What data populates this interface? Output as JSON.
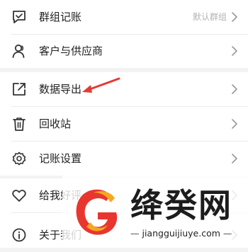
{
  "menu": {
    "group_ledger": {
      "label": "群组记账",
      "value": "默认群组"
    },
    "customers_suppliers": {
      "label": "客户与供应商"
    },
    "data_export": {
      "label": "数据导出"
    },
    "recycle_bin": {
      "label": "回收站"
    },
    "bookkeeping_settings": {
      "label": "记账设置"
    },
    "rate_us": {
      "label": "给我好评"
    },
    "about_us": {
      "label": "关于我们"
    }
  },
  "icons": {
    "group_ledger": "chat-bubble-icon",
    "customers_suppliers": "user-icon",
    "data_export": "export-icon",
    "recycle_bin": "trash-icon",
    "bookkeeping_settings": "gear-icon",
    "rate_us": "heart-icon",
    "about_us": "info-icon",
    "chevron": "chevron-right-icon"
  },
  "annotation": {
    "arrow_color": "#e53935"
  },
  "watermark": {
    "brand": "绛癸网",
    "url": "jiangguijiuye.com",
    "logo_colors": [
      "#f5a623",
      "#e8362f"
    ]
  }
}
